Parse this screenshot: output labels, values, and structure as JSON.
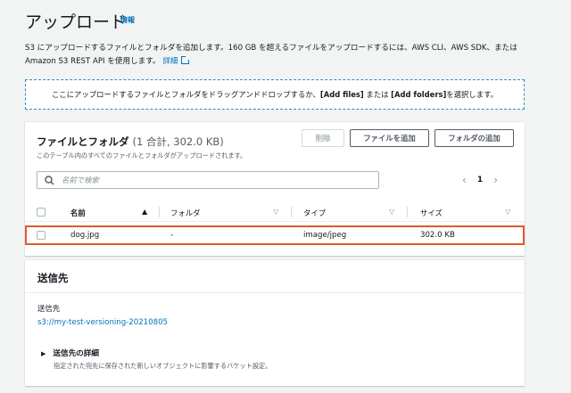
{
  "page": {
    "title": "アップロード",
    "info_link": "情報",
    "description_line1": "S3 にアップロードするファイルとフォルダを追加します。160 GB を超えるファイルをアップロードするには、AWS CLI、AWS SDK、または",
    "description_line2": "Amazon S3 REST API を使用します。",
    "description_link": "詳細"
  },
  "dropzone": {
    "text_before": "ここにアップロードするファイルとフォルダをドラッグアンドドロップするか、",
    "add_files": "[Add files]",
    "middle": " または ",
    "add_folders": "[Add folders]",
    "text_after": " を選択します。"
  },
  "files": {
    "title": "ファイルとフォルダ",
    "summary": "(1 合計, 302.0 KB)",
    "subtitle": "このテーブル内のすべてのファイルとフォルダがアップロードされます。",
    "buttons": {
      "remove": "削除",
      "add_files": "ファイルを追加",
      "add_folder": "フォルダの追加"
    },
    "search_placeholder": "名前で検索",
    "page_number": "1",
    "columns": [
      "名前",
      "フォルダ",
      "タイプ",
      "サイズ"
    ],
    "rows": [
      {
        "name": "dog.jpg",
        "folder": "-",
        "type": "image/jpeg",
        "size": "302.0 KB"
      }
    ]
  },
  "destination": {
    "title": "送信先",
    "label": "送信先",
    "uri": "s3://my-test-versioning-20210805",
    "details_toggle": "送信先の詳細",
    "details_desc": "指定された宛先に保存された新しいオブジェクトに影響するバケット設定。"
  }
}
